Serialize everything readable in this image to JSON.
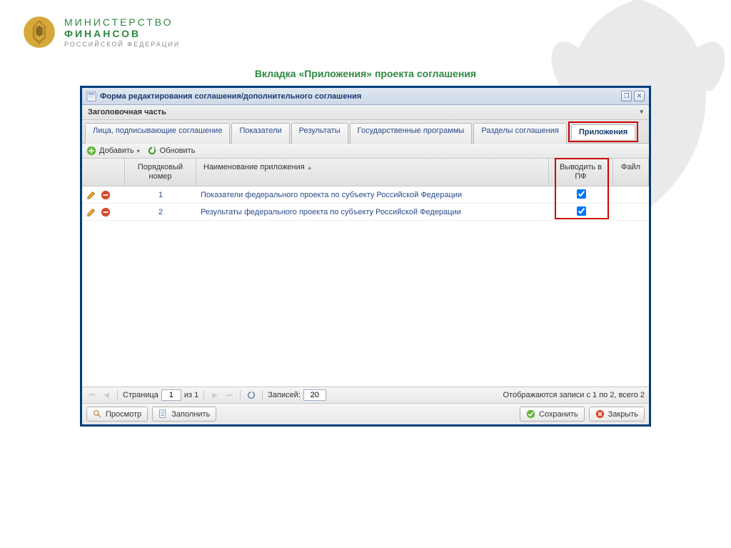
{
  "brand": {
    "line1": "МИНИСТЕРСТВО",
    "line2": "ФИНАНСОВ",
    "line3": "РОССИЙСКОЙ ФЕДЕРАЦИИ"
  },
  "slide_title": "Вкладка «Приложения» проекта соглашения",
  "window": {
    "title": "Форма редактирования соглашения/дополнительного соглашения"
  },
  "section": {
    "title": "Заголовочная часть"
  },
  "tabs": {
    "t0": "Лица, подписывающие соглашение",
    "t1": "Показатели",
    "t2": "Результаты",
    "t3": "Государственные программы",
    "t4": "Разделы соглашения",
    "t5": "Приложения"
  },
  "toolbar": {
    "add": "Добавить",
    "refresh": "Обновить"
  },
  "columns": {
    "num": "Порядковый номер",
    "name": "Наименование приложения",
    "pf": "Выводить в ПФ",
    "file": "Файл"
  },
  "rows": [
    {
      "num": "1",
      "name": "Показатели федерального проекта по субъекту Российской Федерации",
      "pf": true
    },
    {
      "num": "2",
      "name": "Результаты федерального проекта по субъекту Российской Федерации",
      "pf": true
    }
  ],
  "pager": {
    "page_label": "Страница",
    "page": "1",
    "of_label": "из 1",
    "records_label": "Записей:",
    "records": "20",
    "summary": "Отображаются записи с 1 по 2, всего 2"
  },
  "buttons": {
    "preview": "Просмотр",
    "fill": "Заполнить",
    "save": "Сохранить",
    "close": "Закрыть"
  }
}
